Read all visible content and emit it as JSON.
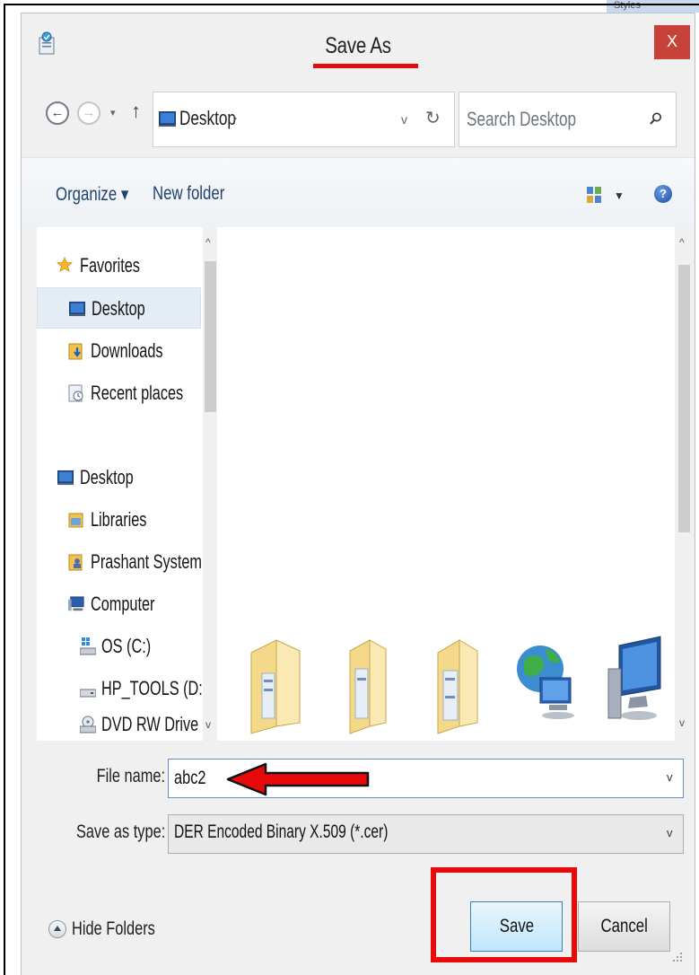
{
  "background_window": {
    "peek_text": "Styles"
  },
  "dialog": {
    "title": "Save As",
    "close_label": "X"
  },
  "address_bar": {
    "back_label": "←",
    "forward_label": "→",
    "recent_dropdown": "▾",
    "up_label": "↑",
    "path": "Desktop",
    "path_separator": "›",
    "dropdown": "v",
    "refresh": "↻",
    "search_placeholder": "Search Desktop"
  },
  "toolbar": {
    "organize_label": "Organize ▾",
    "new_folder_label": "New folder",
    "view_dropdown": "▼",
    "help_label": "?"
  },
  "nav_pane": {
    "scroll_up": "^",
    "scroll_down": "v",
    "items": [
      {
        "label": "Favorites",
        "icon": "star-icon"
      },
      {
        "label": "Desktop",
        "icon": "desktop-icon",
        "selected": true
      },
      {
        "label": "Downloads",
        "icon": "downloads-folder-icon"
      },
      {
        "label": "Recent places",
        "icon": "recent-places-icon"
      },
      {
        "label": "Desktop",
        "icon": "desktop-icon"
      },
      {
        "label": "Libraries",
        "icon": "libraries-icon"
      },
      {
        "label": "Prashant System",
        "icon": "user-folder-icon"
      },
      {
        "label": "Computer",
        "icon": "computer-icon"
      },
      {
        "label": "OS (C:)",
        "icon": "os-drive-icon"
      },
      {
        "label": "HP_TOOLS (D:)",
        "icon": "drive-icon"
      },
      {
        "label": "DVD RW Drive (",
        "icon": "dvd-drive-icon"
      }
    ]
  },
  "file_area": {
    "scroll_up": "^",
    "scroll_down": "v",
    "items": [
      {
        "icon": "folder-icon"
      },
      {
        "icon": "folder-icon"
      },
      {
        "icon": "folder-icon"
      },
      {
        "icon": "network-globe-icon"
      },
      {
        "icon": "computer-monitor-icon"
      }
    ]
  },
  "form": {
    "file_name_label": "File name:",
    "file_name_value": "abc2",
    "file_name_dropdown": "v",
    "save_type_label": "Save as type:",
    "save_type_value": "DER Encoded Binary X.509 (*.cer)",
    "save_type_dropdown": "v"
  },
  "footer": {
    "hide_folders_label": "Hide Folders",
    "save_label": "Save",
    "cancel_label": "Cancel"
  },
  "colors": {
    "annotation_red": "#e8090b",
    "close_button": "#c7433a",
    "link_blue": "#20406e",
    "selected_bg": "#e4ecf6"
  }
}
